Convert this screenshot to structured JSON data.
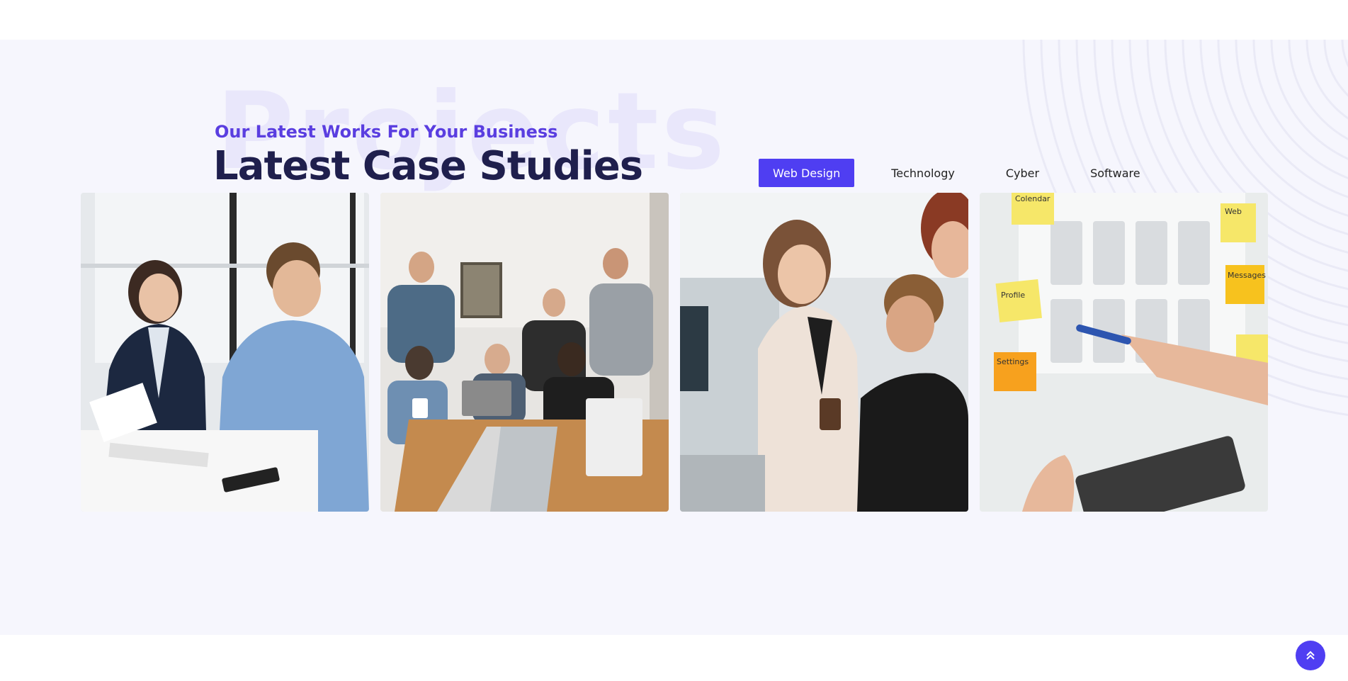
{
  "section": {
    "watermark": "Projects",
    "subtitle": "Our Latest Works For Your Business",
    "title": "Latest Case Studies"
  },
  "filters": [
    {
      "label": "Web Design",
      "active": true
    },
    {
      "label": "Technology",
      "active": false
    },
    {
      "label": "Cyber",
      "active": false
    },
    {
      "label": "Software",
      "active": false
    }
  ],
  "projects": [
    {
      "alt": "business meeting"
    },
    {
      "alt": "team working"
    },
    {
      "alt": "colleagues discussing"
    },
    {
      "alt": "wireframe planning"
    }
  ],
  "sticky_notes": [
    "Colendar",
    "Web",
    "Profile",
    "Settings",
    "Messages"
  ],
  "colors": {
    "accent": "#4f3ef2",
    "subtitle": "#5a3ee0",
    "title": "#1f1f4d",
    "section_bg": "#f6f6fd"
  },
  "icons": {
    "back_to_top": "double-chevron-up-icon"
  }
}
